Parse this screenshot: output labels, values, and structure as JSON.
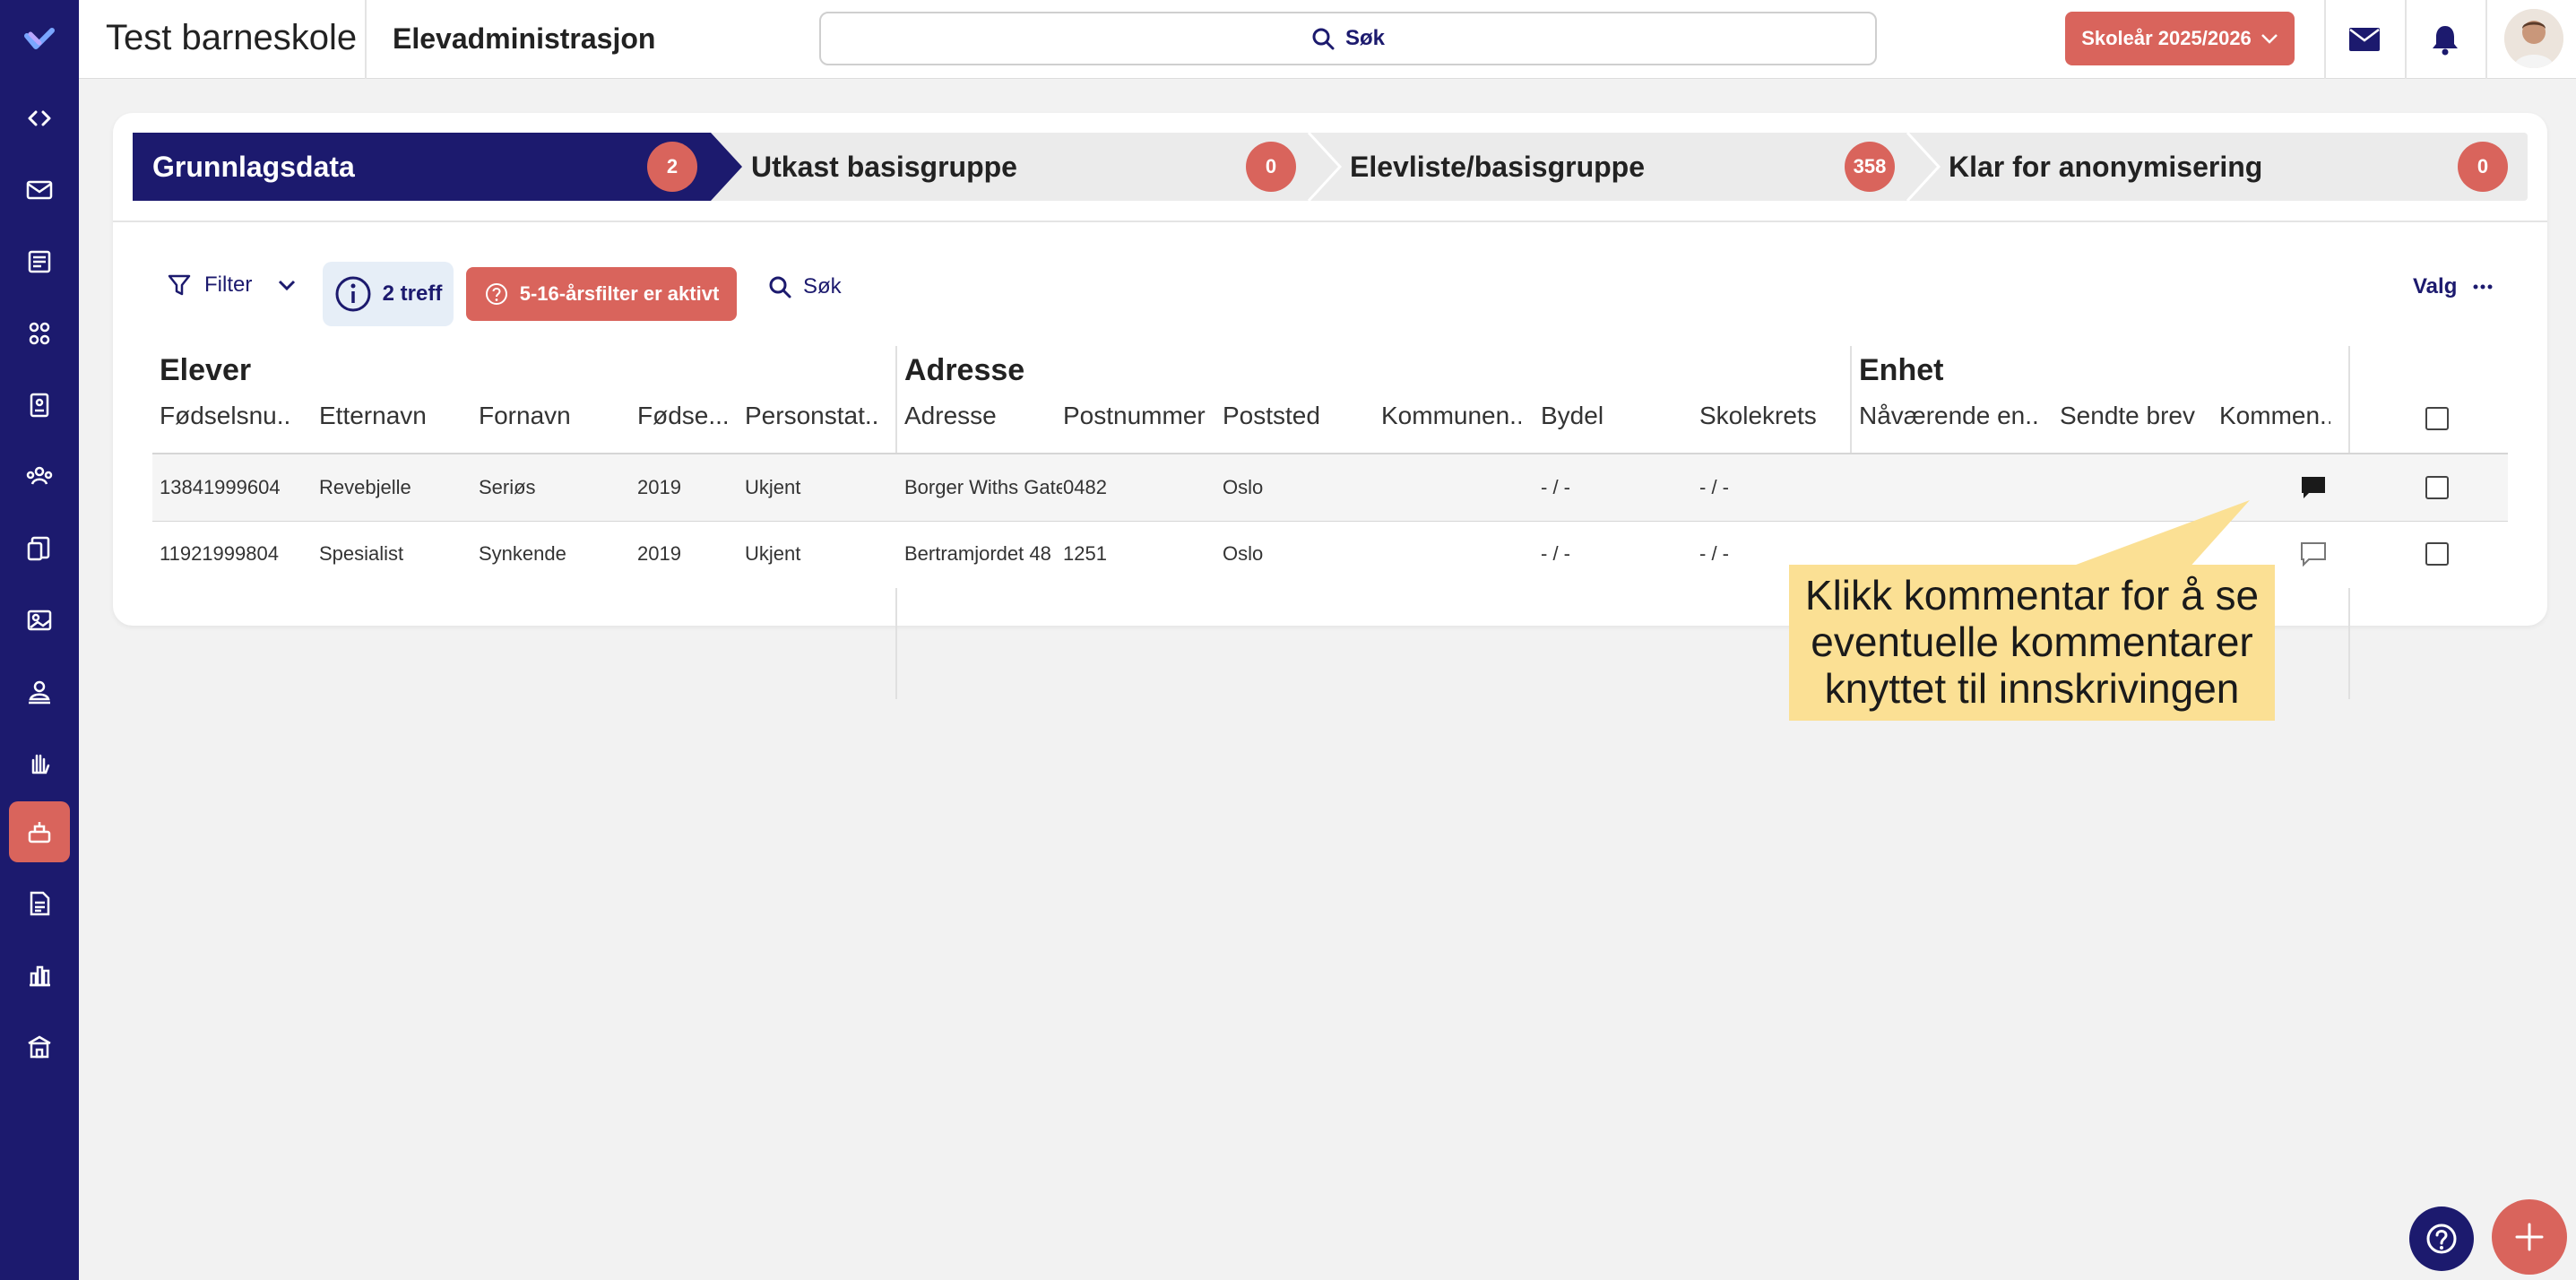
{
  "app": {
    "school_name": "Test barneskole",
    "module_name": "Elevadministrasjon",
    "search_label": "Søk",
    "school_year_button": "Skoleår 2025/2026"
  },
  "steps": [
    {
      "label": "Grunnlagsdata",
      "count": "2"
    },
    {
      "label": "Utkast basisgruppe",
      "count": "0"
    },
    {
      "label": "Elevliste/basisgruppe",
      "count": "358"
    },
    {
      "label": "Klar for anonymisering",
      "count": "0"
    }
  ],
  "toolbar": {
    "filter_label": "Filter",
    "hits_label": "2 treff",
    "age_filter_label": "5-16-årsfilter er aktivt",
    "search_label": "Søk",
    "options_label": "Valg"
  },
  "table": {
    "groups": [
      "Elever",
      "Adresse",
      "Enhet"
    ],
    "columns": [
      "Fødselsnu...",
      "Etternavn",
      "Fornavn",
      "Fødse...",
      "Personstat...",
      "Adresse",
      "Postnummer",
      "Poststed",
      "Kommunen...",
      "Bydel",
      "Skolekrets",
      "Nåværende en...",
      "Sendte brev",
      "Kommen..."
    ],
    "rows": [
      {
        "fnr": "13841999604",
        "etternavn": "Revebjelle",
        "fornavn": "Seriøs",
        "fodselsar": "2019",
        "status": "Ukjent",
        "adresse": "Borger Withs Gate",
        "postnr": "0482",
        "poststed": "Oslo",
        "kommune": "",
        "bydel": "- / -",
        "skolekrets": "- / -",
        "enhet": "",
        "brev": "",
        "comment_filled": true
      },
      {
        "fnr": "11921999804",
        "etternavn": "Spesialist",
        "fornavn": "Synkende",
        "fodselsar": "2019",
        "status": "Ukjent",
        "adresse": "Bertramjordet 48",
        "postnr": "1251",
        "poststed": "Oslo",
        "kommune": "",
        "bydel": "- / -",
        "skolekrets": "- / -",
        "enhet": "",
        "brev": "",
        "comment_filled": false
      }
    ]
  },
  "callout": {
    "lines": [
      "Klikk kommentar for å se",
      "eventuelle kommentarer",
      "knyttet til innskrivingen"
    ]
  },
  "colors": {
    "navy": "#1c1a6e",
    "accent": "#d9645c",
    "callout": "#fbe094"
  },
  "icons": {
    "rail": [
      "code-icon",
      "mail-icon",
      "news-icon",
      "groups-icon",
      "id-card-icon",
      "team-icon",
      "documents-icon",
      "gallery-icon",
      "user-upload-icon",
      "hand-icon",
      "enrollment-icon",
      "report-icon",
      "chart-icon",
      "school-icon"
    ]
  }
}
